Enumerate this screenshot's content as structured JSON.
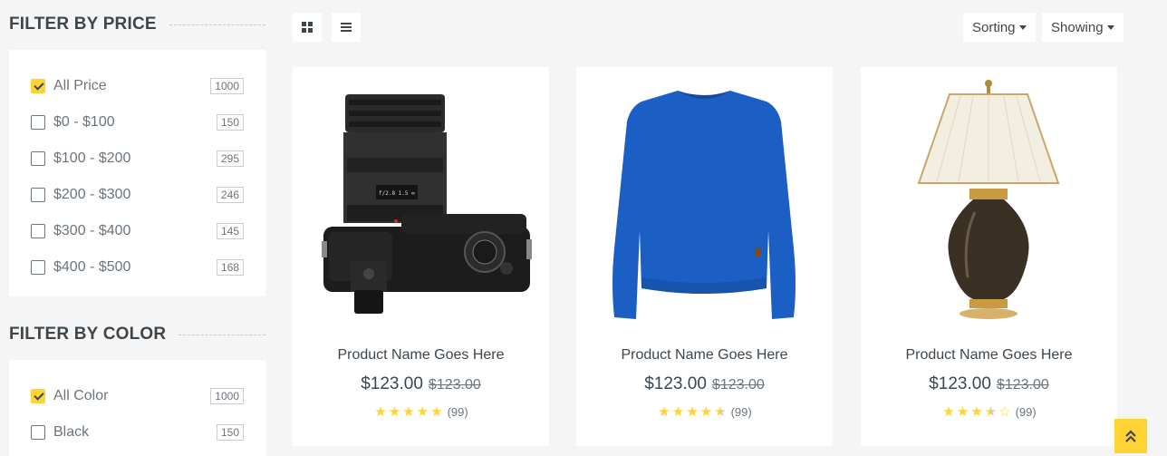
{
  "price_filter": {
    "title": "Filter by price",
    "items": [
      {
        "label": "All Price",
        "count": "1000",
        "checked": true
      },
      {
        "label": "$0 - $100",
        "count": "150",
        "checked": false
      },
      {
        "label": "$100 - $200",
        "count": "295",
        "checked": false
      },
      {
        "label": "$200 - $300",
        "count": "246",
        "checked": false
      },
      {
        "label": "$300 - $400",
        "count": "145",
        "checked": false
      },
      {
        "label": "$400 - $500",
        "count": "168",
        "checked": false
      }
    ]
  },
  "color_filter": {
    "title": "Filter by color",
    "items": [
      {
        "label": "All Color",
        "count": "1000",
        "checked": true
      },
      {
        "label": "Black",
        "count": "150",
        "checked": false
      }
    ]
  },
  "toolbar": {
    "grid_icon": "grid-icon",
    "list_icon": "list-icon",
    "sorting_label": "Sorting",
    "showing_label": "Showing"
  },
  "products": [
    {
      "name": "Product Name Goes Here",
      "price": "$123.00",
      "old_price": "$123.00",
      "rating": 5,
      "reviews": "(99)",
      "image": "camera"
    },
    {
      "name": "Product Name Goes Here",
      "price": "$123.00",
      "old_price": "$123.00",
      "rating": 4.5,
      "reviews": "(99)",
      "image": "sweater"
    },
    {
      "name": "Product Name Goes Here",
      "price": "$123.00",
      "old_price": "$123.00",
      "rating": 3.5,
      "reviews": "(99)",
      "image": "lamp"
    }
  ],
  "colors": {
    "accent": "#FFD333",
    "text": "#3d464d",
    "muted": "#6c757d",
    "background": "#f5f5f5"
  },
  "back_to_top_icon": "double-chevron-up-icon"
}
